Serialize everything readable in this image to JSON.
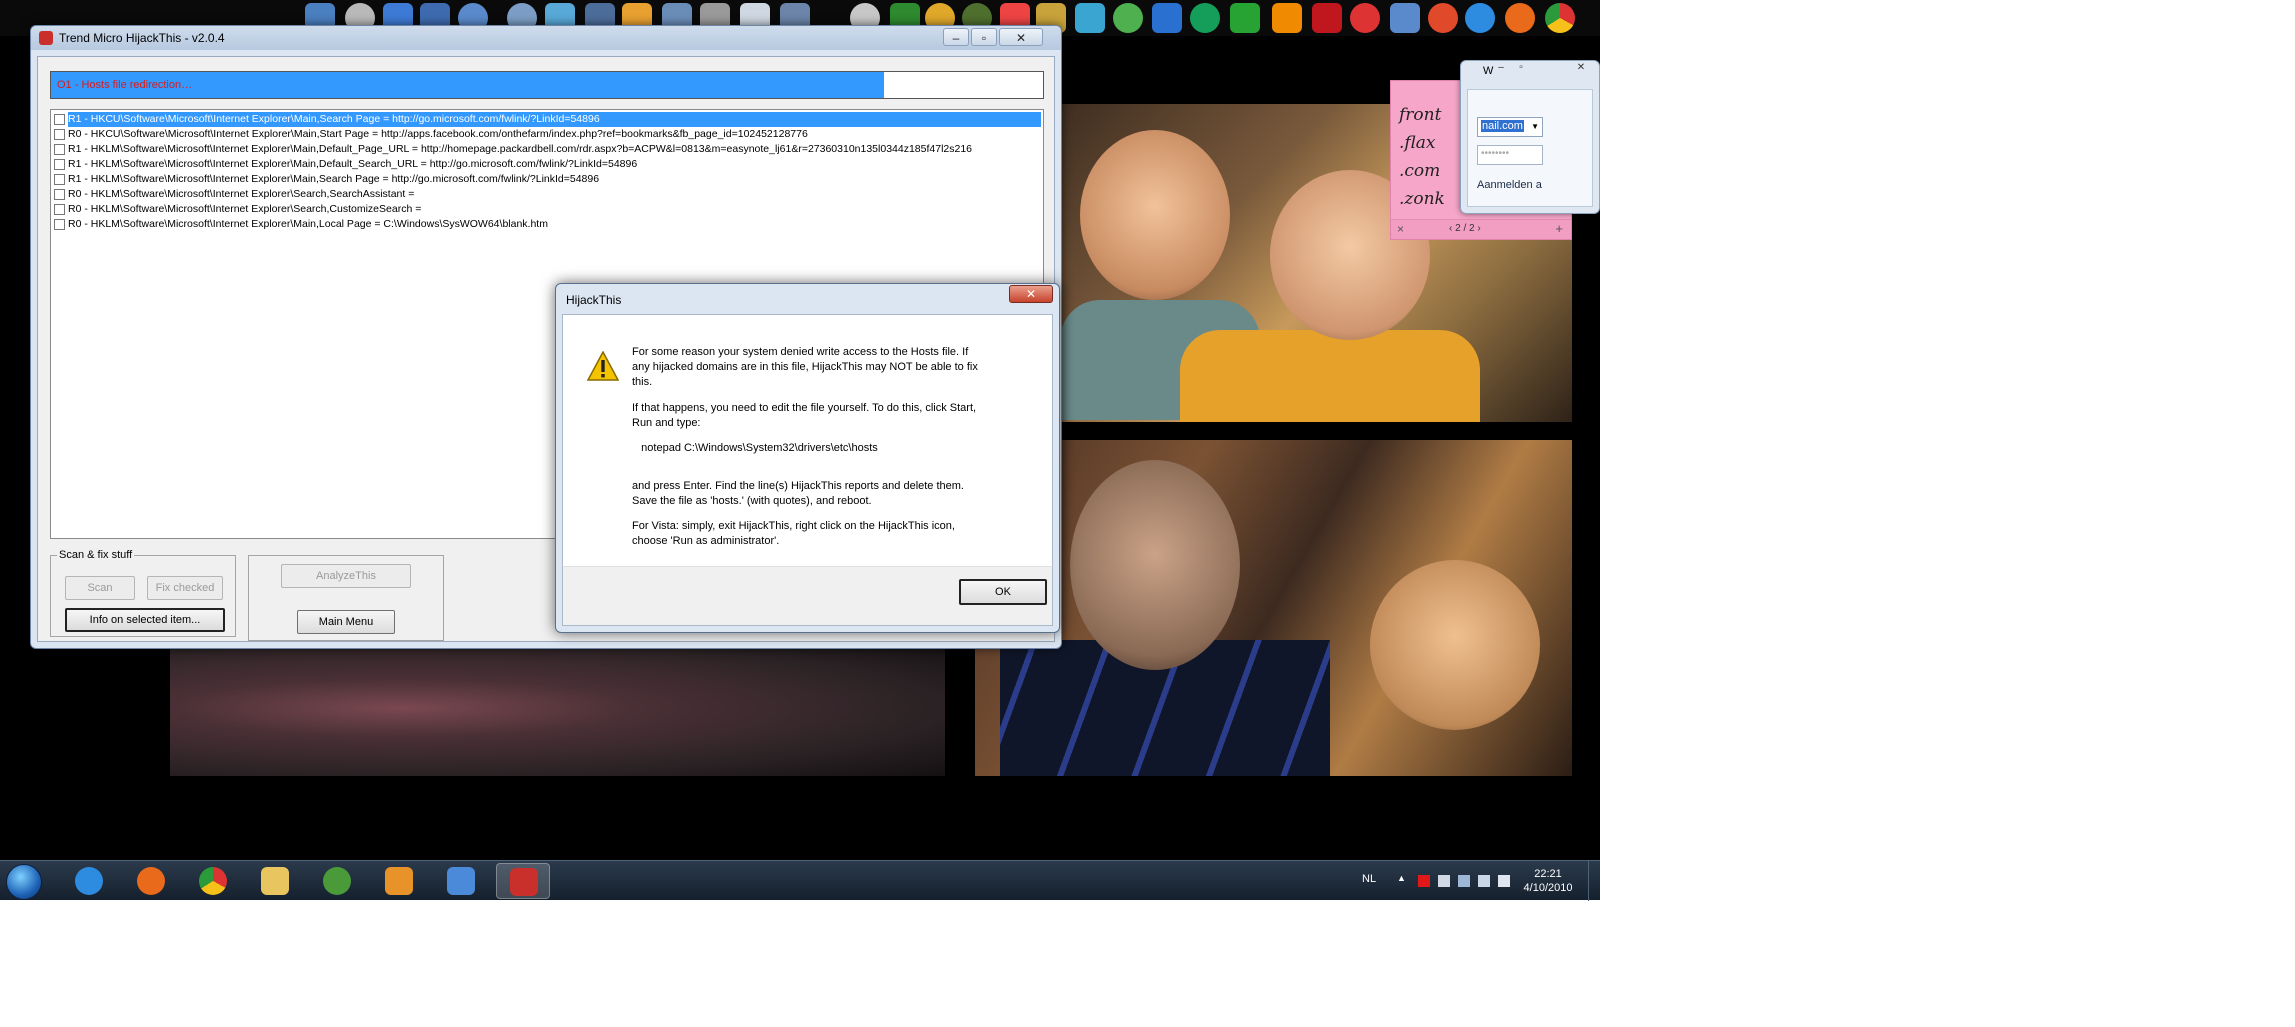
{
  "hijackthis": {
    "title": "Trend Micro HijackThis - v2.0.4",
    "progress_label": "O1 - Hosts file redirection…",
    "progress_fraction": 0.84,
    "results": [
      "R1 - HKCU\\Software\\Microsoft\\Internet Explorer\\Main,Search Page = http://go.microsoft.com/fwlink/?LinkId=54896",
      "R0 - HKCU\\Software\\Microsoft\\Internet Explorer\\Main,Start Page = http://apps.facebook.com/onthefarm/index.php?ref=bookmarks&fb_page_id=102452128776",
      "R1 - HKLM\\Software\\Microsoft\\Internet Explorer\\Main,Default_Page_URL = http://homepage.packardbell.com/rdr.aspx?b=ACPW&l=0813&m=easynote_lj61&r=27360310n135l0344z185f47l2s216",
      "R1 - HKLM\\Software\\Microsoft\\Internet Explorer\\Main,Default_Search_URL = http://go.microsoft.com/fwlink/?LinkId=54896",
      "R1 - HKLM\\Software\\Microsoft\\Internet Explorer\\Main,Search Page = http://go.microsoft.com/fwlink/?LinkId=54896",
      "R0 - HKLM\\Software\\Microsoft\\Internet Explorer\\Search,SearchAssistant =",
      "R0 - HKLM\\Software\\Microsoft\\Internet Explorer\\Search,CustomizeSearch =",
      "R0 - HKLM\\Software\\Microsoft\\Internet Explorer\\Main,Local Page = C:\\Windows\\SysWOW64\\blank.htm"
    ],
    "selected_row": 0,
    "group_scan_label": "Scan & fix stuff",
    "scan_label": "Scan",
    "fix_checked_label": "Fix checked",
    "info_label": "Info on selected item...",
    "analyze_label": "AnalyzeThis",
    "main_menu_label": "Main Menu"
  },
  "dialog": {
    "title": "HijackThis",
    "close_glyph": "✕",
    "paragraph1": "For some reason your system denied write access to the Hosts file. If\nany hijacked domains are in this file, HijackThis may NOT be able to fix\nthis.",
    "paragraph2": "If that happens, you need to edit the file yourself. To do this, click Start,\nRun and type:",
    "command": "   notepad C:\\Windows\\System32\\drivers\\etc\\hosts",
    "paragraph3": "and press Enter. Find the line(s) HijackThis reports and delete them.\nSave the file as 'hosts.' (with quotes), and reboot.",
    "paragraph4": "For Vista: simply, exit HijackThis, right click on the HijackThis icon,\nchoose 'Run as administrator'.",
    "ok_label": "OK"
  },
  "sticky": {
    "lines": [
      "front",
      ".flax",
      ".com",
      ".zonk"
    ],
    "pager": "2 / 2",
    "close_glyph": "×",
    "add_glyph": "+"
  },
  "messenger": {
    "title": "W",
    "account_value": "nail.com",
    "password_mask": "••••••••",
    "login_label": "Aanmelden a"
  },
  "taskbar": {
    "language": "NL",
    "time": "22:21",
    "date": "4/10/2010",
    "pinned": [
      "internet-explorer",
      "firefox",
      "chrome",
      "explorer",
      "messenger",
      "media-player",
      "paint",
      "hijackthis"
    ],
    "active_index": 7
  },
  "colors": {
    "progress_fill": "#3399ff",
    "progress_text": "#d91c1c",
    "selection": "#3399ff"
  }
}
